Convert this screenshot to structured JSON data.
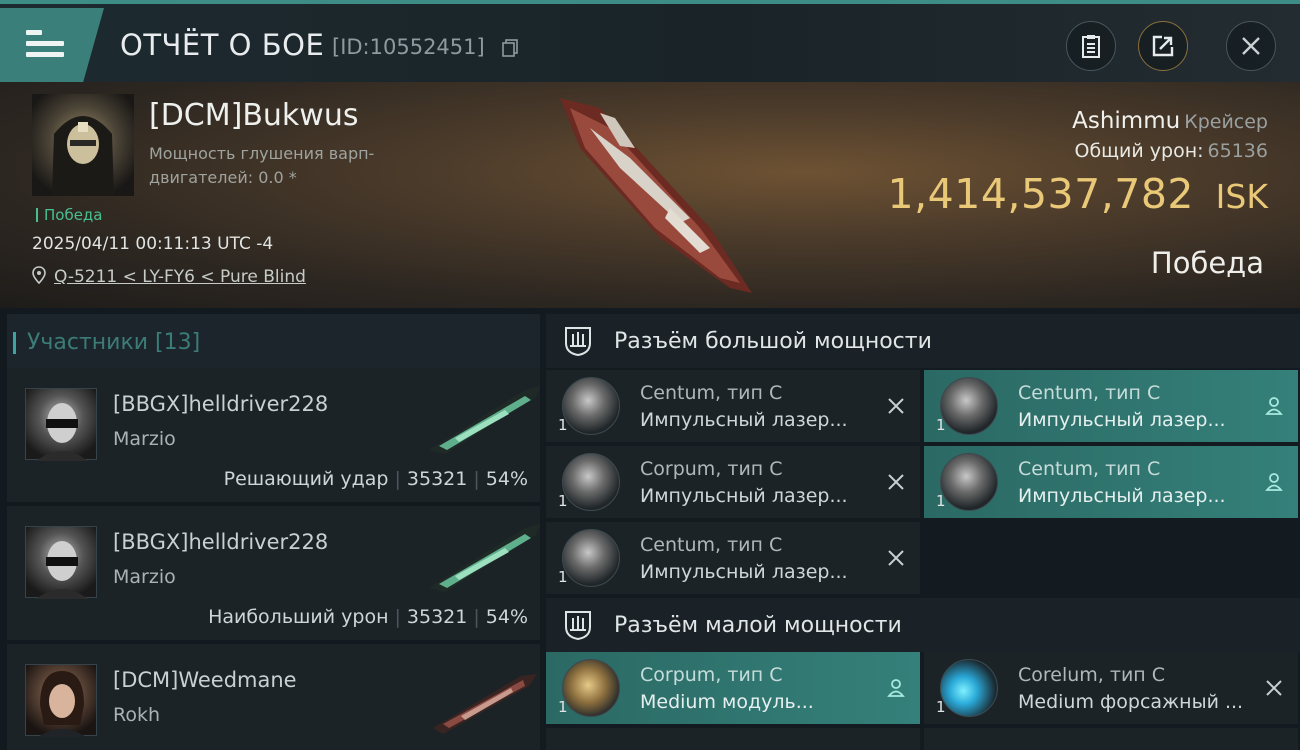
{
  "header": {
    "title": "ОТЧЁТ О БОЕ",
    "report_id": "[ID:10552451]"
  },
  "victim": {
    "name": "[DCM]Bukwus",
    "warp_disruption": "Мощность глушения варп-двигателей: 0.0 *",
    "outcome_tag": "Победа",
    "datetime": "2025/04/11 00:11:13 UTC -4",
    "location": "Q-5211 < LY-FY6 < Pure Blind",
    "ship_name": "Ashimmu",
    "ship_class": "Крейсер",
    "total_damage_label": "Общий урон:",
    "total_damage": "65136",
    "isk_value": "1,414,537,782",
    "isk_unit": "ISK",
    "result": "Победа"
  },
  "participants": {
    "header": "Участники [13]",
    "rows": [
      {
        "name": "[BBGX]helldriver228",
        "ship": "Marzio",
        "role": "Решающий удар",
        "damage": "35321",
        "percent": "54%"
      },
      {
        "name": "[BBGX]helldriver228",
        "ship": "Marzio",
        "role": "Наибольший урон",
        "damage": "35321",
        "percent": "54%"
      },
      {
        "name": "[DCM]Weedmane",
        "ship": "Rokh",
        "role": "",
        "damage": "",
        "percent": ""
      }
    ]
  },
  "slots": {
    "high": {
      "title": "Разъём большой мощности",
      "modules": [
        {
          "name": "Centum, тип C",
          "desc": "Импульсный лазер...",
          "qty": "1",
          "state": "destroyed",
          "icon": "laser-turret-icon"
        },
        {
          "name": "Centum, тип C",
          "desc": "Импульсный лазер...",
          "qty": "1",
          "state": "dropped",
          "icon": "laser-turret-icon"
        },
        {
          "name": "Corpum, тип C",
          "desc": "Импульсный лазер...",
          "qty": "1",
          "state": "destroyed",
          "icon": "laser-turret-icon"
        },
        {
          "name": "Centum, тип C",
          "desc": "Импульсный лазер...",
          "qty": "1",
          "state": "dropped",
          "icon": "laser-turret-icon"
        },
        {
          "name": "Centum, тип C",
          "desc": "Импульсный лазер...",
          "qty": "1",
          "state": "destroyed",
          "icon": "laser-turret-icon"
        }
      ]
    },
    "mid": {
      "title": "Разъём малой мощности",
      "modules": [
        {
          "name": "Corpum, тип C",
          "desc": "Medium модуль...",
          "qty": "1",
          "state": "dropped",
          "icon": "module-icon"
        },
        {
          "name": "Corelum, тип C",
          "desc": "Medium форсажный ...",
          "qty": "1",
          "state": "destroyed",
          "icon": "afterburner-icon"
        }
      ]
    }
  },
  "colors": {
    "accent_teal": "#3b7f7a",
    "isk_gold": "#e9c878",
    "victory_green": "#48c08e"
  }
}
